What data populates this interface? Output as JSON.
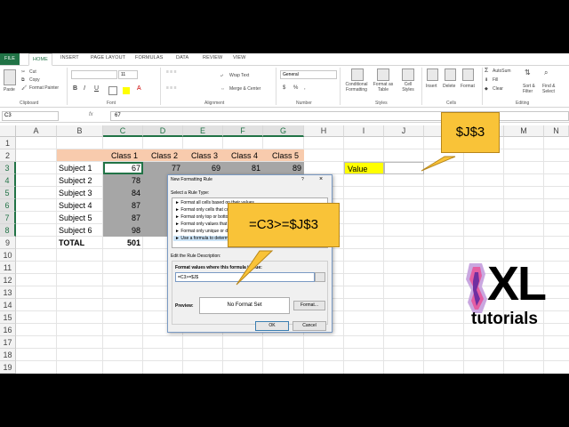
{
  "ribbon": {
    "tabs": [
      "FILE",
      "HOME",
      "INSERT",
      "PAGE LAYOUT",
      "FORMULAS",
      "DATA",
      "REVIEW",
      "VIEW"
    ],
    "clipboard": {
      "paste": "Paste",
      "cut": "Cut",
      "copy": "Copy",
      "format_painter": "Format Painter",
      "title": "Clipboard"
    },
    "font": {
      "size": "11",
      "bold": "B",
      "italic": "I",
      "underline": "U",
      "title": "Font"
    },
    "alignment": {
      "wrap": "Wrap Text",
      "merge": "Merge & Center",
      "title": "Alignment"
    },
    "number": {
      "format": "General",
      "currency": "$",
      "percent": "%",
      "comma": ",",
      "title": "Number"
    },
    "styles": {
      "conditional": "Conditional Formatting",
      "format_table": "Format as Table",
      "cell_styles": "Cell Styles",
      "title": "Styles"
    },
    "cells": {
      "insert": "Insert",
      "delete": "Delete",
      "format": "Format",
      "title": "Cells"
    },
    "editing": {
      "autosum": "AutoSum",
      "fill": "Fill",
      "clear": "Clear",
      "sort": "Sort & Filter",
      "find": "Find & Select",
      "title": "Editing"
    }
  },
  "formula_bar": {
    "name_box": "C3",
    "fx": "fx",
    "value": "67"
  },
  "sheet": {
    "columns": [
      "A",
      "B",
      "C",
      "D",
      "E",
      "F",
      "G",
      "H",
      "I",
      "J",
      "K",
      "L",
      "M",
      "N"
    ],
    "rows": [
      "1",
      "2",
      "3",
      "4",
      "5",
      "6",
      "7",
      "8",
      "9",
      "10",
      "11",
      "12",
      "13",
      "14",
      "15",
      "16",
      "17",
      "18",
      "19"
    ],
    "class_headers": [
      "Class 1",
      "Class 2",
      "Class 3",
      "Class 4",
      "Class 5"
    ],
    "subjects": [
      "Subject 1",
      "Subject 2",
      "Subject 3",
      "Subject 4",
      "Subject 5",
      "Subject 6"
    ],
    "total_label": "TOTAL",
    "values": [
      [
        "67",
        "77",
        "69",
        "81",
        "89"
      ],
      [
        "78",
        "",
        "",
        "",
        ""
      ],
      [
        "84",
        "",
        "",
        "",
        ""
      ],
      [
        "87",
        "",
        "",
        "",
        ""
      ],
      [
        "87",
        "",
        "",
        "",
        ""
      ],
      [
        "98",
        "",
        "",
        "",
        ""
      ]
    ],
    "total": "501",
    "value_label": "Value",
    "colors": {
      "header_fill": "#f8cbad",
      "value_fill": "#ffff00",
      "highlight": "#a6a6a6",
      "excel_green": "#217346"
    }
  },
  "dialog": {
    "title": "New Formatting Rule",
    "help": "?",
    "close": "×",
    "select_rule_type": "Select a Rule Type:",
    "rule_types": [
      "► Format all cells based on their values",
      "► Format only cells that contain",
      "► Format only top or bottom ranked values",
      "► Format only values that are above or below average",
      "► Format only unique or duplicate values",
      "► Use a formula to determine which cells to format"
    ],
    "edit_desc": "Edit the Rule Description:",
    "formula_label": "Format values where this formula is true:",
    "formula_value": "=C3>=$J$",
    "preview_label": "Preview:",
    "preview_text": "No Format Set",
    "format_button": "Format...",
    "ok": "OK",
    "cancel": "Cancel"
  },
  "callouts": {
    "top": "$J$3",
    "formula": "=C3>=$J$3"
  },
  "logo": {
    "xl": "XL",
    "tutorials": "tutorials"
  }
}
